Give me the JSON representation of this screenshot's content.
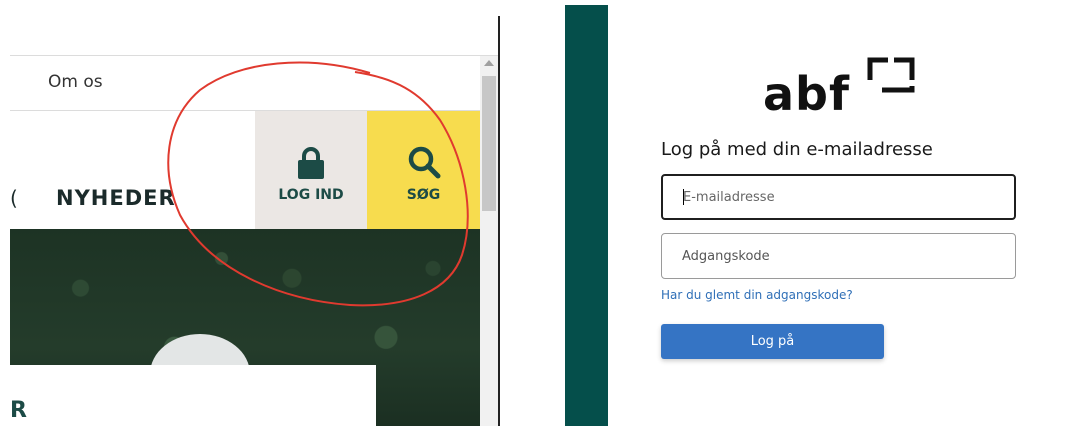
{
  "website": {
    "top_menu": {
      "about_label": "Om os"
    },
    "nav": {
      "partial_item": "(",
      "news_label": "NYHEDER"
    },
    "login_button": {
      "label": "LOG IND",
      "icon": "lock-icon"
    },
    "search_button": {
      "label": "SØG",
      "icon": "magnifier-icon"
    },
    "card": {
      "partial_title": "R"
    }
  },
  "login_form": {
    "logo_text": "abf",
    "title": "Log på med din e-mailadresse",
    "email_placeholder": "E-mailadresse",
    "password_placeholder": "Adgangskode",
    "forgot_link": "Har du glemt din adgangskode?",
    "submit_label": "Log på"
  },
  "colors": {
    "brand_teal": "#054f4b",
    "search_yellow": "#f7dc4e",
    "login_grey": "#ebe7e4",
    "primary_button": "#3574c4",
    "link_blue": "#2f6fb7",
    "annotation_red": "#e03a2f"
  }
}
